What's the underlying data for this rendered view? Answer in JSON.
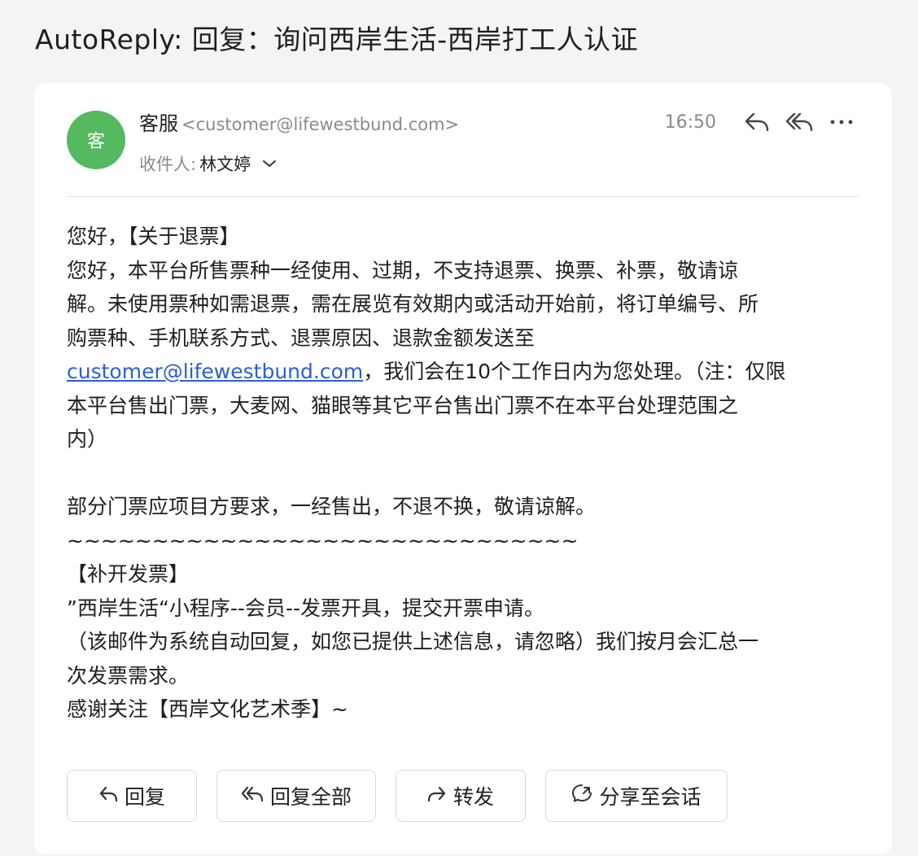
{
  "email": {
    "subject": "AutoReply: 回复：询问西岸生活-西岸打工人认证",
    "avatar_text": "客",
    "sender_name": "客服",
    "sender_email": "<customer@lifewestbund.com>",
    "to_label": "收件人:",
    "to_name": "林文婷",
    "time": "16:50",
    "body": {
      "line1": "您好，【关于退票】",
      "line2": "您好，本平台所售票种一经使用、过期，不支持退票、换票、补票，敬请谅",
      "line3": "解。未使用票种如需退票，需在展览有效期内或活动开始前，将订单编号、所",
      "line4": "购票种、手机联系方式、退票原因、退款金额发送至",
      "link": "customer@lifewestbund.com",
      "line5_rest": "，我们会在10个工作日内为您处理。（注：仅限",
      "line6": "本平台售出门票，大麦网、猫眼等其它平台售出门票不在本平台处理范围之",
      "line7": "内）",
      "line8": "部分门票应项目方要求，一经售出，不退不换，敬请谅解。",
      "line9": "~~~~~~~~~~~~~~~~~~~~~~~~~~~~~~",
      "line10": "【补开发票】",
      "line11": "”西岸生活“小程序--会员--发票开具，提交开票申请。",
      "line12": "（该邮件为系统自动回复，如您已提供上述信息，请忽略）我们按月会汇总一",
      "line13": "次发票需求。",
      "line14": "感谢关注【西岸文化艺术季】~"
    }
  },
  "actions": {
    "reply": "回复",
    "reply_all": "回复全部",
    "forward": "转发",
    "share": "分享至会话"
  },
  "icons": {
    "reply": "reply-icon",
    "reply_all": "reply-all-icon",
    "more": "more-icon",
    "chevron": "chevron-down-icon",
    "forward": "forward-icon",
    "share": "chat-share-icon"
  },
  "colors": {
    "avatar": "#54b95f",
    "link": "#2a5fd6"
  }
}
